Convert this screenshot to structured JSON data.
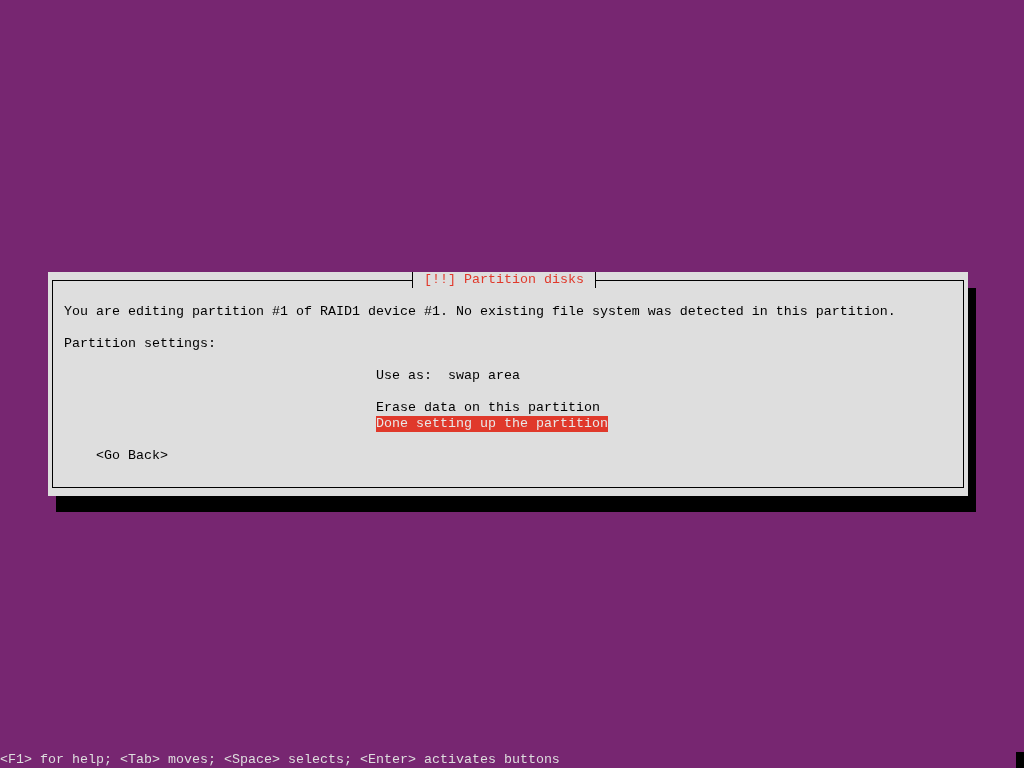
{
  "screen": {
    "dialog": {
      "title": "[!!] Partition disks",
      "message": "You are editing partition #1 of RAID1 device #1. No existing file system was detected in this partition.",
      "section_label": "Partition settings:",
      "settings": [
        {
          "label": "Use as:",
          "value": "swap area",
          "selected": false
        }
      ],
      "actions": [
        {
          "label": "Erase data on this partition",
          "selected": false
        },
        {
          "label": "Done setting up the partition",
          "selected": true
        }
      ],
      "buttons": [
        {
          "label": "<Go Back>",
          "selected": false
        }
      ]
    },
    "status_bar": {
      "text": "<F1> for help; <Tab> moves; <Space> selects; <Enter> activates buttons"
    }
  }
}
